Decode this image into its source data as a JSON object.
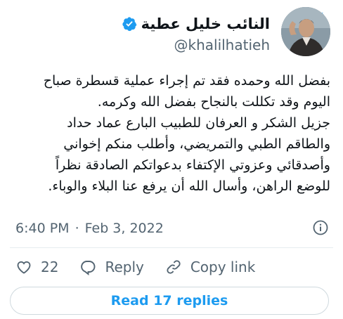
{
  "author": {
    "display_name": "النائب خليل عطية",
    "handle": "@khalilhatieh",
    "verified": true
  },
  "tweet": {
    "lines": [
      "بفضل الله وحمده فقد تم إجراء عملية قسطرة صباح",
      "اليوم وقد تكللت بالنجاح بفضل الله وكرمه.",
      "جزيل الشكر و العرفان للطبيب البارع عماد حداد",
      "والطاقم الطبي والتمريضي، وأطلب منكم إخواني",
      "وأصدقائي وعزوتي الإكتفاء بدعواتكم الصادقة نظراً",
      "للوضع الراهن، وأسال الله أن يرفع عنا البلاء والوباء."
    ],
    "time": "6:40 PM",
    "separator": "·",
    "date": "Feb 3, 2022"
  },
  "actions": {
    "like_count": "22",
    "reply_label": "Reply",
    "copy_link_label": "Copy link"
  },
  "read_replies_label": "Read 17 replies",
  "colors": {
    "twitter_blue": "#1d9bf0",
    "secondary_text": "#536471",
    "border": "#cfd9de"
  },
  "icons": [
    "twitter-logo-icon",
    "verified-badge-icon",
    "info-icon",
    "heart-icon",
    "reply-icon",
    "link-icon"
  ]
}
